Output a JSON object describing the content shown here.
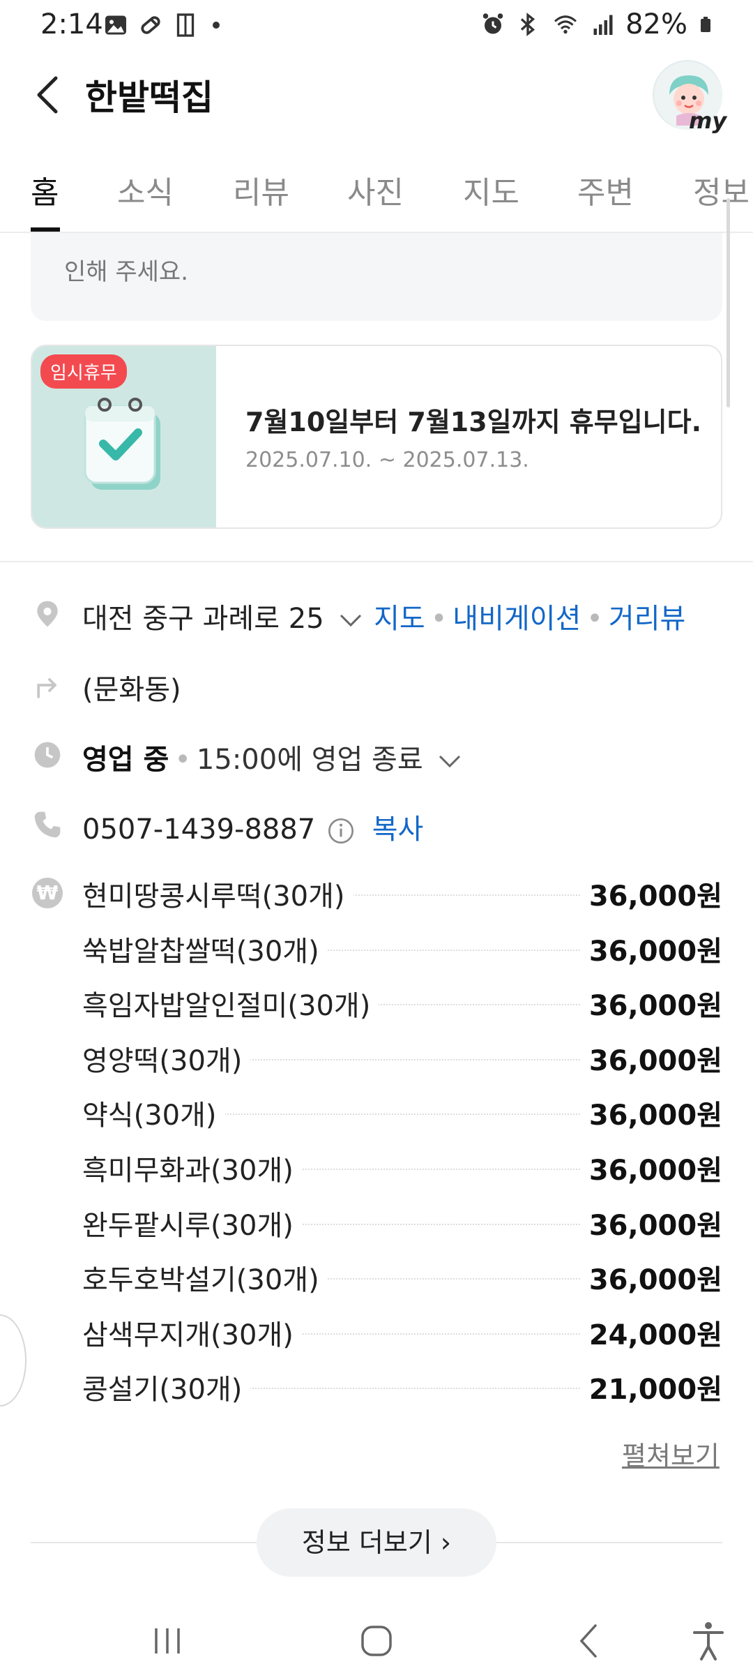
{
  "status_bar": {
    "time": "2:14",
    "battery": "82%",
    "left_icons": [
      "image-icon",
      "pill-icon",
      "door-icon",
      "dot-icon"
    ],
    "right_icons": [
      "alarm-icon",
      "bluetooth-icon",
      "wifi-icon",
      "signal-icon",
      "battery-icon"
    ]
  },
  "header": {
    "title": "한밭떡집",
    "my_label": "my"
  },
  "tabs": [
    {
      "label": "홈",
      "active": true
    },
    {
      "label": "소식"
    },
    {
      "label": "리뷰"
    },
    {
      "label": "사진"
    },
    {
      "label": "지도"
    },
    {
      "label": "주변"
    },
    {
      "label": "정보"
    }
  ],
  "notice": {
    "text_partial": "인해 주세요."
  },
  "holiday": {
    "badge": "임시휴무",
    "title": "7월10일부터 7월13일까지 휴무입니다.",
    "date_range": "2025.07.10. ~ 2025.07.13."
  },
  "info": {
    "address": "대전 중구 과례로 25",
    "map_link": "지도",
    "navigation_link": "내비게이션",
    "streetview_link": "거리뷰",
    "jibun": "(문화동)",
    "status": "영업 중",
    "closing": "15:00에 영업 종료",
    "phone": "0507-1439-8887",
    "copy_link": "복사"
  },
  "menu": [
    {
      "name": "현미땅콩시루떡(30개)",
      "price": "36,000원"
    },
    {
      "name": "쑥밥알찹쌀떡(30개)",
      "price": "36,000원"
    },
    {
      "name": "흑임자밥알인절미(30개)",
      "price": "36,000원"
    },
    {
      "name": "영양떡(30개)",
      "price": "36,000원"
    },
    {
      "name": "약식(30개)",
      "price": "36,000원"
    },
    {
      "name": "흑미무화과(30개)",
      "price": "36,000원"
    },
    {
      "name": "완두팥시루(30개)",
      "price": "36,000원"
    },
    {
      "name": "호두호박설기(30개)",
      "price": "36,000원"
    },
    {
      "name": "삼색무지개(30개)",
      "price": "24,000원"
    },
    {
      "name": "콩설기(30개)",
      "price": "21,000원"
    }
  ],
  "expand_label": "펼쳐보기",
  "more_info_label": "정보 더보기 ›",
  "colors": {
    "link_blue": "#1367c8",
    "badge_red": "#f34a50",
    "holiday_bg": "#cfe7e3"
  }
}
